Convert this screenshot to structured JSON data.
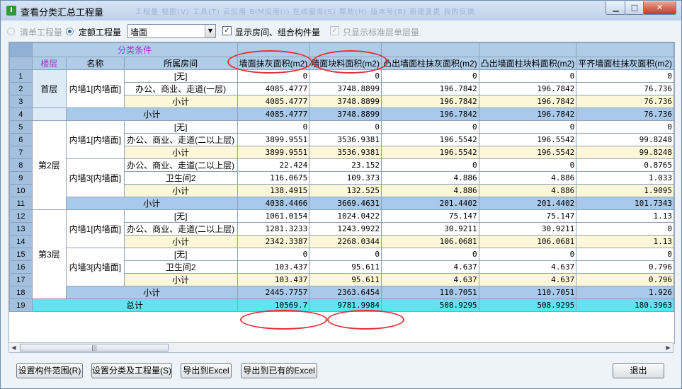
{
  "window": {
    "title": "查看分类汇总工程量",
    "ghost_menu": "工程量  视图(V)  工具(T)  云应用  BIM应用(I)  在线服务(S)  帮助(H)  版本号(B)  新建变更  我的反馈"
  },
  "toolbar": {
    "radio_bill": "清单工程量",
    "radio_quota": "定额工程量",
    "combo_value": "墙面",
    "check_show_rooms": "显示房间、组合构件量",
    "check_std_floor": "只显示标准层单层量"
  },
  "grid": {
    "condition_header": "分类条件",
    "headers": {
      "floor": "楼层",
      "name": "名称",
      "room": "所属房间",
      "c1": "墙面抹灰面积(m2)",
      "c2": "墙面块料面积(m2)",
      "c3": "凸出墙面柱抹灰面积(m2)",
      "c4": "凸出墙面柱块料面积(m2)",
      "c5": "平齐墙面柱抹灰面积(m2)"
    },
    "floors": {
      "f1": "首层",
      "f2": "第2层",
      "f3": "第3层"
    },
    "components": {
      "a": "内墙1[内墙面]",
      "b": "内墙1[内墙面]",
      "c": "内墙3[内墙面]",
      "d": "内墙1[内墙面]",
      "e": "内墙3[内墙面]"
    },
    "subtotal": "小计",
    "total": "总计",
    "rows": [
      {
        "n": "1",
        "room": "[无]",
        "v": [
          "0",
          "0",
          "0",
          "0",
          "0"
        ]
      },
      {
        "n": "2",
        "room": "办公、商业、走道(一层)",
        "v": [
          "4085.4777",
          "3748.8899",
          "196.7842",
          "196.7842",
          "76.736"
        ]
      },
      {
        "n": "3",
        "room": "小计",
        "v": [
          "4085.4777",
          "3748.8899",
          "196.7842",
          "196.7842",
          "76.736"
        ]
      },
      {
        "n": "4",
        "room": "小计",
        "v": [
          "4085.4777",
          "3748.8899",
          "196.7842",
          "196.7842",
          "76.736"
        ]
      },
      {
        "n": "5",
        "room": "[无]",
        "v": [
          "0",
          "0",
          "0",
          "0",
          "0"
        ]
      },
      {
        "n": "6",
        "room": "办公、商业、走道(二以上层)",
        "v": [
          "3899.9551",
          "3536.9381",
          "196.5542",
          "196.5542",
          "99.8248"
        ]
      },
      {
        "n": "7",
        "room": "小计",
        "v": [
          "3899.9551",
          "3536.9381",
          "196.5542",
          "196.5542",
          "99.8248"
        ]
      },
      {
        "n": "8",
        "room": "办公、商业、走道(二以上层)",
        "v": [
          "22.424",
          "23.152",
          "0",
          "0",
          "0.8765"
        ]
      },
      {
        "n": "9",
        "room": "卫生间2",
        "v": [
          "116.0675",
          "109.373",
          "4.886",
          "4.886",
          "1.033"
        ]
      },
      {
        "n": "10",
        "room": "小计",
        "v": [
          "138.4915",
          "132.525",
          "4.886",
          "4.886",
          "1.9095"
        ]
      },
      {
        "n": "11",
        "room": "小计",
        "v": [
          "4038.4466",
          "3669.4631",
          "201.4402",
          "201.4402",
          "101.7343"
        ]
      },
      {
        "n": "12",
        "room": "[无]",
        "v": [
          "1061.0154",
          "1024.0422",
          "75.147",
          "75.147",
          "1.13"
        ]
      },
      {
        "n": "13",
        "room": "办公、商业、走道(二以上层)",
        "v": [
          "1281.3233",
          "1243.9922",
          "30.9211",
          "30.9211",
          "0"
        ]
      },
      {
        "n": "14",
        "room": "小计",
        "v": [
          "2342.3387",
          "2268.0344",
          "106.0681",
          "106.0681",
          "1.13"
        ]
      },
      {
        "n": "15",
        "room": "[无]",
        "v": [
          "0",
          "0",
          "0",
          "0",
          "0"
        ]
      },
      {
        "n": "16",
        "room": "卫生间2",
        "v": [
          "103.437",
          "95.611",
          "4.637",
          "4.637",
          "0.796"
        ]
      },
      {
        "n": "17",
        "room": "小计",
        "v": [
          "103.437",
          "95.611",
          "4.637",
          "4.637",
          "0.796"
        ]
      },
      {
        "n": "18",
        "room": "小计",
        "v": [
          "2445.7757",
          "2363.6454",
          "110.7051",
          "110.7051",
          "1.926"
        ]
      },
      {
        "n": "19",
        "room": "总计",
        "v": [
          "10569.7",
          "9781.9984",
          "508.9295",
          "508.9295",
          "180.3963"
        ]
      }
    ]
  },
  "buttons": {
    "set_range": "设置构件范围(R)",
    "set_class": "设置分类及工程量(S)",
    "export_excel": "导出到Excel",
    "export_existing": "导出到已有的Excel",
    "exit": "退出"
  },
  "annotation_color": "#e0343a"
}
